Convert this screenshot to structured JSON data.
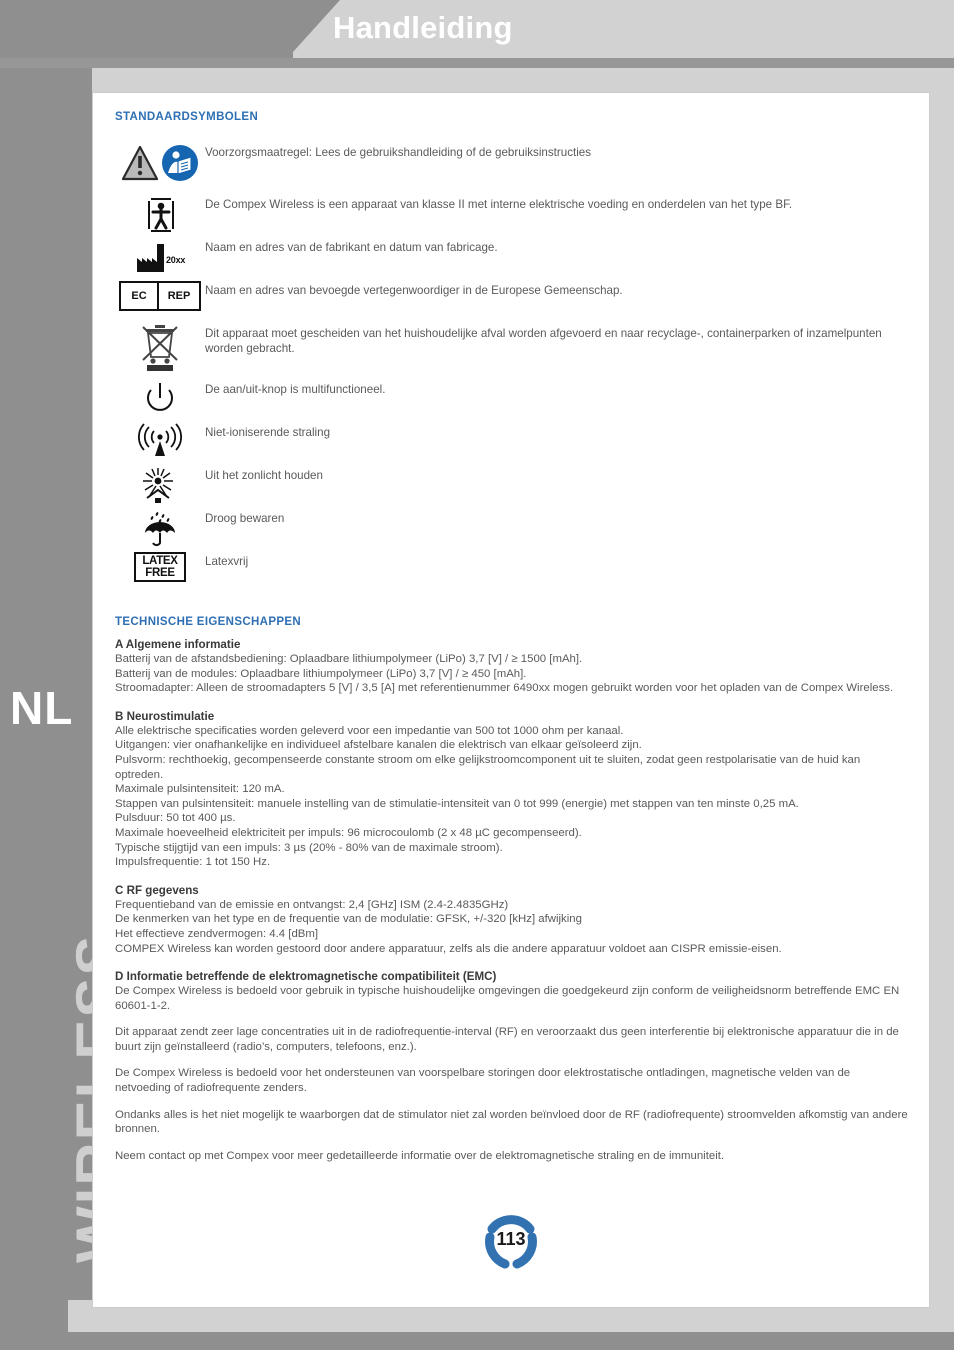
{
  "header": {
    "title": "Handleiding"
  },
  "sidebar": {
    "language_code": "NL",
    "product_name": "WIRELESS"
  },
  "colors": {
    "accent_blue": "#2e6fb3",
    "badge_blue": "#3272b0",
    "band_gray": "#8f8f8f",
    "panel_gray": "#d2d2d2",
    "body_text": "#5a5a5a"
  },
  "symbols_section": {
    "heading": "STANDAARDSYMBOLEN",
    "rows": [
      {
        "icon": "warning-triangle-and-read-instructions-icon",
        "text": "Voorzorgsmaatregel: Lees de gebruikshandleiding of de gebruiksinstructies"
      },
      {
        "icon": "type-bf-applied-part-icon",
        "text": "De Compex Wireless is een apparaat van klasse II met interne elektrische voeding en onderdelen van het type BF."
      },
      {
        "icon": "manufacturer-factory-icon",
        "text": "Naam en adres van de fabrikant en datum van fabricage."
      },
      {
        "icon": "ec-rep-authorised-representative-icon",
        "text": "Naam en adres van bevoegde vertegenwoordiger in de Europese Gemeenschap."
      },
      {
        "icon": "weee-crossed-out-wheelie-bin-icon",
        "text": "Dit apparaat moet gescheiden van het huishoudelijke afval worden afgevoerd en naar recyclage-, containerparken of inzamelpunten worden gebracht."
      },
      {
        "icon": "power-button-icon",
        "text": "De aan/uit-knop is multifunctioneel."
      },
      {
        "icon": "non-ionizing-radiation-icon",
        "text": "Niet-ioniserende straling"
      },
      {
        "icon": "keep-away-from-sunlight-icon",
        "text": "Uit het zonlicht houden"
      },
      {
        "icon": "keep-dry-umbrella-icon",
        "text": "Droog bewaren"
      },
      {
        "icon": "latex-free-icon",
        "text": "Latexvrij"
      }
    ],
    "icon_labels": {
      "factory_year": "20xx",
      "ec": "EC",
      "rep": "REP",
      "latex": "LATEX",
      "free": "FREE"
    }
  },
  "technical_section": {
    "heading": "TECHNISCHE EIGENSCHAPPEN",
    "blocks": [
      {
        "title": "A Algemene informatie",
        "lines": [
          "Batterij van de afstandsbediening: Oplaadbare lithiumpolymeer (LiPo) 3,7 [V] / ≥ 1500 [mAh].",
          "Batterij van de modules: Oplaadbare lithiumpolymeer (LiPo) 3,7 [V] / ≥ 450 [mAh].",
          "Stroomadapter: Alleen de stroomadapters 5 [V] / 3,5 [A] met referentienummer 6490xx mogen gebruikt worden voor het opladen van de Compex Wireless."
        ]
      },
      {
        "title": "B Neurostimulatie",
        "lines": [
          "Alle elektrische specificaties worden geleverd voor een impedantie van 500 tot 1000 ohm per kanaal.",
          "Uitgangen: vier onafhankelijke en individueel afstelbare kanalen die elektrisch van elkaar geïsoleerd zijn.",
          "Pulsvorm: rechthoekig, gecompenseerde constante stroom om elke gelijkstroomcomponent uit te sluiten, zodat geen restpolarisatie van de huid kan optreden.",
          "Maximale pulsintensiteit: 120 mA.",
          "Stappen van pulsintensiteit: manuele instelling van de stimulatie-intensiteit van 0 tot 999 (energie) met stappen van ten minste 0,25 mA.",
          "Pulsduur: 50 tot 400 µs.",
          "Maximale hoeveelheid elektriciteit per impuls: 96 microcoulomb (2 x 48 µC gecompenseerd).",
          "Typische stijgtijd van een impuls: 3 µs (20% - 80% van de maximale stroom).",
          "Impulsfrequentie: 1 tot 150 Hz."
        ]
      },
      {
        "title": "C RF gegevens",
        "lines": [
          "Frequentieband van de emissie en ontvangst: 2,4 [GHz] ISM (2.4-2.4835GHz)",
          "De kenmerken van het type en de frequentie van de modulatie: GFSK, +/-320 [kHz] afwijking",
          "Het effectieve zendvermogen: 4.4 [dBm]",
          "COMPEX Wireless kan worden gestoord door andere apparatuur, zelfs als die andere apparatuur voldoet aan CISPR emissie-eisen."
        ]
      },
      {
        "title": "D Informatie betreffende de elektromagnetische compatibiliteit (EMC)",
        "lines": [
          "De Compex Wireless is bedoeld voor gebruik in typische huishoudelijke omgevingen die goedgekeurd zijn conform de veiligheidsnorm betreffende EMC EN 60601-1-2."
        ]
      }
    ],
    "trailing_paragraphs": [
      "Dit apparaat zendt zeer lage concentraties uit in de radiofrequentie-interval (RF) en veroorzaakt dus geen interferentie bij elektronische apparatuur die in de buurt zijn geïnstalleerd (radio’s, computers, telefoons, enz.).",
      "De Compex Wireless is bedoeld voor het ondersteunen van voorspelbare storingen door elektrostatische ontladingen, magnetische velden van de netvoeding of radiofrequente zenders.",
      "Ondanks alles is het niet mogelijk te waarborgen dat de stimulator niet zal worden beïnvloed door de RF (radiofrequente) stroomvelden afkomstig van andere bronnen.",
      "Neem contact op met Compex voor meer gedetailleerde informatie over de elektromagnetische straling en de immuniteit."
    ]
  },
  "footer": {
    "page_number": "113"
  }
}
